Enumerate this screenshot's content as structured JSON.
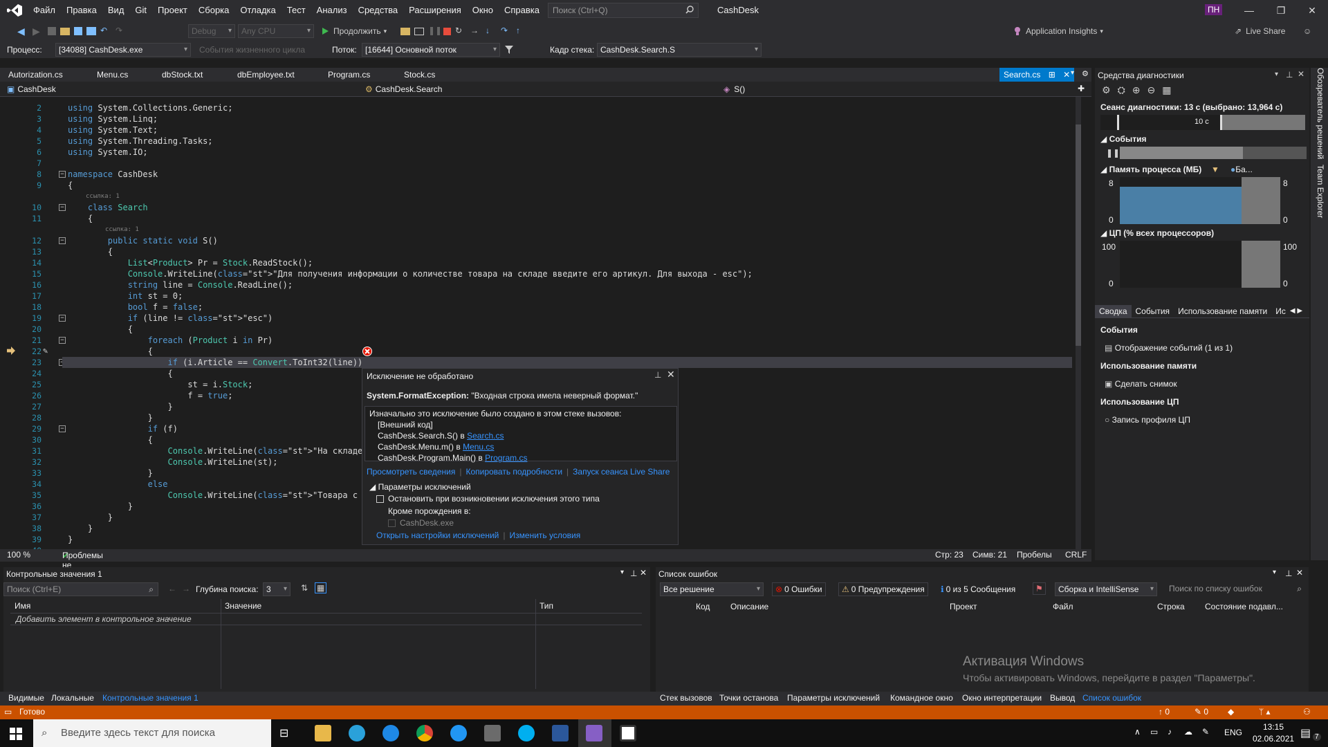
{
  "menubar": {
    "items": [
      "Файл",
      "Правка",
      "Вид",
      "Git",
      "Проект",
      "Сборка",
      "Отладка",
      "Тест",
      "Анализ",
      "Средства",
      "Расширения",
      "Окно",
      "Справка"
    ],
    "search_placeholder": "Поиск (Ctrl+Q)",
    "app_title": "CashDesk",
    "user_initials": "ПН"
  },
  "toolbar": {
    "config": "Debug",
    "platform": "Any CPU",
    "continue_label": "Продолжить",
    "app_insights": "Application Insights",
    "live_share": "Live Share",
    "process_label": "Процесс:",
    "process_value": "[34088] CashDesk.exe",
    "lifecycle_label": "События жизненного цикла",
    "thread_label": "Поток:",
    "thread_value": "[16644] Основной поток",
    "stackframe_label": "Кадр стека:",
    "stackframe_value": "CashDesk.Search.S"
  },
  "tabs": [
    "Autorization.cs",
    "Menu.cs",
    "dbStock.txt",
    "dbEmployee.txt",
    "Program.cs",
    "Stock.cs"
  ],
  "active_tab": "Search.cs",
  "navbar": {
    "project": "CashDesk",
    "class": "CashDesk.Search",
    "member": "S()"
  },
  "editor": {
    "refs1": "ссылка: 1",
    "refs2": "ссылка: 1",
    "lines": [
      {
        "n": "2",
        "t": "using System.Collections.Generic;"
      },
      {
        "n": "3",
        "t": "using System.Linq;"
      },
      {
        "n": "4",
        "t": "using System.Text;"
      },
      {
        "n": "5",
        "t": "using System.Threading.Tasks;"
      },
      {
        "n": "6",
        "t": "using System.IO;"
      },
      {
        "n": "7",
        "t": ""
      },
      {
        "n": "8",
        "t": "namespace CashDesk"
      },
      {
        "n": "9",
        "t": "{"
      },
      {
        "n": "10",
        "t": "    class Search"
      },
      {
        "n": "11",
        "t": "    {"
      },
      {
        "n": "12",
        "t": "        public static void S()"
      },
      {
        "n": "13",
        "t": "        {"
      },
      {
        "n": "14",
        "t": "            List<Product> Pr = Stock.ReadStock();"
      },
      {
        "n": "15",
        "t": "            Console.WriteLine(\"Для получения информации о количестве товара на складе введите его артикул. Для выхода - esc\");"
      },
      {
        "n": "16",
        "t": "            string line = Console.ReadLine();"
      },
      {
        "n": "17",
        "t": "            int st = 0;"
      },
      {
        "n": "18",
        "t": "            bool f = false;"
      },
      {
        "n": "19",
        "t": "            if (line != \"esc\")"
      },
      {
        "n": "20",
        "t": "            {"
      },
      {
        "n": "21",
        "t": "                foreach (Product i in Pr)"
      },
      {
        "n": "22",
        "t": "                {"
      },
      {
        "n": "23",
        "t": "                    if (i.Article == Convert.ToInt32(line))"
      },
      {
        "n": "24",
        "t": "                    {"
      },
      {
        "n": "25",
        "t": "                        st = i.Stock;"
      },
      {
        "n": "26",
        "t": "                        f = true;"
      },
      {
        "n": "27",
        "t": "                    }"
      },
      {
        "n": "28",
        "t": "                }"
      },
      {
        "n": "29",
        "t": "                if (f)"
      },
      {
        "n": "30",
        "t": "                {"
      },
      {
        "n": "31",
        "t": "                    Console.WriteLine(\"На складе есть:\");"
      },
      {
        "n": "32",
        "t": "                    Console.WriteLine(st);"
      },
      {
        "n": "33",
        "t": "                }"
      },
      {
        "n": "34",
        "t": "                else"
      },
      {
        "n": "35",
        "t": "                    Console.WriteLine(\"Товара с таким артику"
      },
      {
        "n": "36",
        "t": "            }"
      },
      {
        "n": "37",
        "t": "        }"
      },
      {
        "n": "38",
        "t": "    }"
      },
      {
        "n": "39",
        "t": "}"
      },
      {
        "n": "40",
        "t": ""
      }
    ]
  },
  "exception": {
    "title": "Исключение не обработано",
    "type": "System.FormatException:",
    "message": "\"Входная строка имела неверный формат.\"",
    "stack_intro": "Изначально это исключение было создано в этом стеке вызовов:",
    "stack_ext": "[Внешний код]",
    "frames": [
      {
        "fn": "CashDesk.Search.S() в ",
        "file": "Search.cs"
      },
      {
        "fn": "CashDesk.Menu.m() в ",
        "file": "Menu.cs"
      },
      {
        "fn": "CashDesk.Program.Main() в ",
        "file": "Program.cs"
      }
    ],
    "link_details": "Просмотреть сведения",
    "link_copy": "Копировать подробности",
    "link_liveshare": "Запуск сеанса Live Share",
    "settings_header": "Параметры исключений",
    "break_label": "Остановить при возникновении исключения этого типа",
    "except_label": "Кроме порождения в:",
    "except_module": "CashDesk.exe",
    "link_open_settings": "Открыть настройки исключений",
    "link_change": "Изменить условия"
  },
  "edstatus": {
    "zoom": "100 %",
    "problems": "Проблемы не найдены.",
    "line": "Стр: 23",
    "col": "Симв: 21",
    "spaces": "Пробелы",
    "eol": "CRLF"
  },
  "diag": {
    "title": "Средства диагностики",
    "session": "Сеанс диагностики: 13 с (выбрано: 13,964 с)",
    "timeline_label": "10 с",
    "events_header": "События",
    "memory_header": "Память процесса (МБ)",
    "memory_legend": "Ба...",
    "mem_max": "8",
    "mem_min": "0",
    "mem_max_r": "8",
    "mem_min_r": "0",
    "cpu_header": "ЦП (% всех процессоров)",
    "cpu_max": "100",
    "cpu_min": "0",
    "cpu_max_r": "100",
    "cpu_min_r": "0",
    "tabs": [
      "Сводка",
      "События",
      "Использование памяти",
      "Ис"
    ],
    "sec_events": "События",
    "show_events": "Отображение событий (1 из 1)",
    "sec_memory": "Использование памяти",
    "snapshot": "Сделать снимок",
    "sec_cpu": "Использование ЦП",
    "cpu_profile": "Запись профиля ЦП"
  },
  "side_tabs": [
    "Обозреватель решений",
    "Team Explorer"
  ],
  "watch": {
    "title": "Контрольные значения 1",
    "search_placeholder": "Поиск (Ctrl+E)",
    "depth_label": "Глубина поиска:",
    "depth_value": "3",
    "col_name": "Имя",
    "col_value": "Значение",
    "col_type": "Тип",
    "add_hint": "Добавить элемент в контрольное значение"
  },
  "errors": {
    "title": "Список ошибок",
    "scope": "Все решение",
    "errors_btn": "0 Ошибки",
    "warnings_btn": "0 Предупреждения",
    "messages_btn": "0 из 5 Сообщения",
    "build_filter": "Сборка и IntelliSense",
    "search_placeholder": "Поиск по списку ошибок",
    "cols": [
      "Код",
      "Описание",
      "Проект",
      "Файл",
      "Строка",
      "Состояние подавл..."
    ],
    "watermark1": "Активация Windows",
    "watermark2": "Чтобы активировать Windows, перейдите в раздел \"Параметры\"."
  },
  "bottom_tabs_left": [
    "Видимые",
    "Локальные",
    "Контрольные значения 1"
  ],
  "bottom_tabs_right": [
    "Стек вызовов",
    "Точки останова",
    "Параметры исключений",
    "Командное окно",
    "Окно интерпретации",
    "Вывод",
    "Список ошибок"
  ],
  "statusbar": {
    "ready": "Готово",
    "up": "0",
    "pencil": "0"
  },
  "taskbar": {
    "search_placeholder": "Введите здесь текст для поиска",
    "lang": "ENG",
    "time": "13:15",
    "date": "02.06.2021",
    "notif": "7"
  },
  "colors": {
    "accent": "#007acc",
    "status": "#ca5100",
    "panel": "#252526",
    "editor": "#1e1e1e"
  }
}
